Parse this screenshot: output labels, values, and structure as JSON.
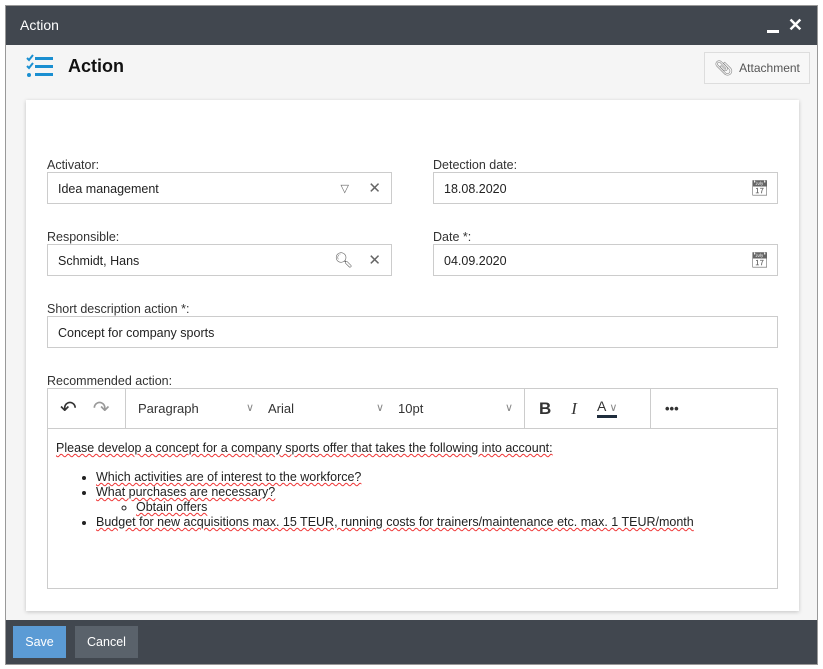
{
  "window": {
    "title": "Action"
  },
  "header": {
    "title": "Action",
    "attachment": "Attachment"
  },
  "form": {
    "activator": {
      "label": "Activator:",
      "value": "Idea management"
    },
    "detection_date": {
      "label": "Detection date:",
      "value": "18.08.2020"
    },
    "responsible": {
      "label": "Responsible:",
      "value": "Schmidt, Hans"
    },
    "date": {
      "label": "Date *:",
      "value": "04.09.2020"
    },
    "short_desc": {
      "label": "Short description action *:",
      "value": "Concept for company sports"
    },
    "recommended": {
      "label": "Recommended action:"
    }
  },
  "editor": {
    "block": "Paragraph",
    "font": "Arial",
    "size": "10pt",
    "intro": "Please develop a concept for a company sports offer that takes the following into account:",
    "items": [
      "Which activities are of interest to the workforce?",
      "What purchases are necessary?",
      "Obtain offers",
      "Budget for new acquisitions max. 15 TEUR, running costs for trainers/maintenance etc. max. 1 TEUR/month"
    ]
  },
  "footer": {
    "save": "Save",
    "cancel": "Cancel"
  }
}
